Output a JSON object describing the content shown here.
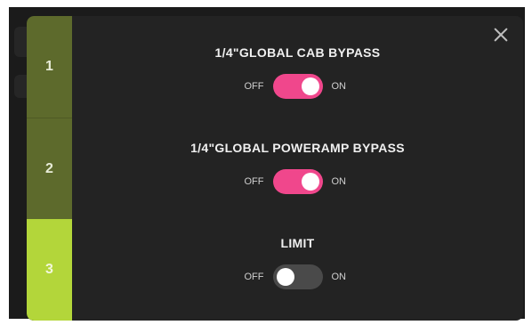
{
  "tabs": [
    {
      "label": "1",
      "active": false
    },
    {
      "label": "2",
      "active": false
    },
    {
      "label": "3",
      "active": true
    }
  ],
  "close_icon": "close-icon",
  "settings": [
    {
      "title": "1/4\"GLOBAL CAB BYPASS",
      "off_label": "OFF",
      "on_label": "ON",
      "state": "on"
    },
    {
      "title": "1/4\"GLOBAL POWERAMP BYPASS",
      "off_label": "OFF",
      "on_label": "ON",
      "state": "on"
    },
    {
      "title": "LIMIT",
      "off_label": "OFF",
      "on_label": "ON",
      "state": "off"
    }
  ],
  "colors": {
    "toggle_on": "#f0478c",
    "toggle_off": "#4a4a4a",
    "tab_active": "#b3d63a",
    "tab_inactive": "#5d6a2c",
    "dialog_bg": "#232323"
  }
}
